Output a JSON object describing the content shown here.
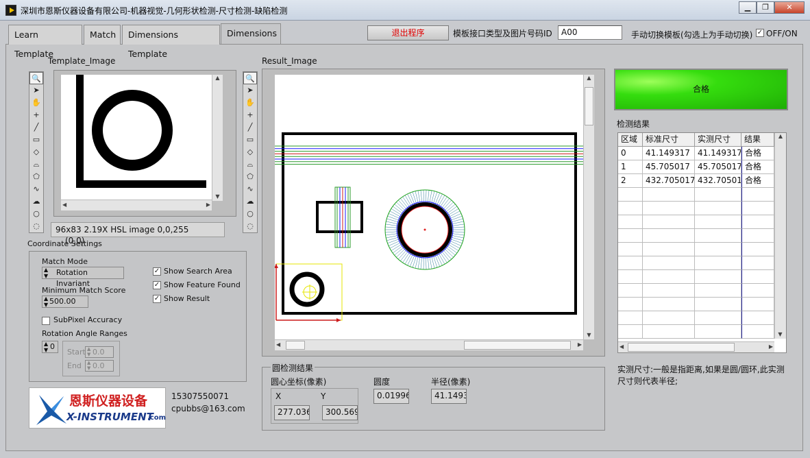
{
  "window": {
    "title": "深圳市恩斯仪器设备有限公司-机器视觉-几何形状检测-尺寸检测-缺陷检测",
    "controls": [
      "▁",
      "❐",
      "✕"
    ]
  },
  "tabs": [
    {
      "label": "Learn Template"
    },
    {
      "label": "Match"
    },
    {
      "label": "Dimensions Template"
    },
    {
      "label": "Dimensions"
    }
  ],
  "header": {
    "exit_label": "退出程序",
    "template_id_label": "模板接口类型及图片号码ID",
    "template_id_value": "A00",
    "manual_switch_label": "手动切换模板(勾选上为手动切换)",
    "manual_switch_check": "✓",
    "manual_switch_state": "OFF/ON"
  },
  "template_image": {
    "title": "Template_Image",
    "info": "96x83 2.19X HSL image 0,0,255",
    "coords": "(0,0)"
  },
  "result_image": {
    "title": "Result_Image"
  },
  "coordinate_settings": {
    "title": "Coordinate Settings",
    "match_mode_label": "Match Mode",
    "match_mode_value": "Rotation Invariant",
    "min_score_label": "Minimum Match Score",
    "min_score_value": "500.00",
    "subpixel_label": "SubPixel Accuracy",
    "angle_ranges_label": "Rotation Angle Ranges",
    "angle_index": "0",
    "start_label": "Start",
    "start_value": "0.0",
    "end_label": "End",
    "end_value": "0.0",
    "show_search_area": "Show Search Area",
    "show_feature_found": "Show Feature Found",
    "show_result": "Show Result",
    "check": "✓"
  },
  "contact": {
    "logo_cn": "恩斯仪器设备",
    "logo_en": "X-INSTRUMENT",
    "logo_suffix": ".com",
    "phone": "15307550071",
    "email": "cpubbs@163.com"
  },
  "status": {
    "label": "合格",
    "color": "#2fd10b"
  },
  "results_table": {
    "title": "检测结果",
    "headers": [
      "区域",
      "标准尺寸",
      "实测尺寸",
      "结果"
    ],
    "rows": [
      [
        "0",
        "41.149317",
        "41.149317",
        "合格"
      ],
      [
        "1",
        "45.705017",
        "45.705017",
        "合格"
      ],
      [
        "2",
        "432.705017",
        "432.70501",
        "合格"
      ]
    ]
  },
  "note": {
    "line1": "实测尺寸:一般是指距离,如果是圆/圆环,此实测",
    "line2": "尺寸则代表半径;"
  },
  "circle_result": {
    "title": "圆检测结果",
    "center_label": "圆心坐标(像素)",
    "x_label": "X",
    "y_label": "Y",
    "x_value": "277.036",
    "y_value": "300.569",
    "roundness_label": "圆度",
    "roundness_value": "0.01996",
    "radius_label": "半径(像素)",
    "radius_value": "41.1493"
  }
}
